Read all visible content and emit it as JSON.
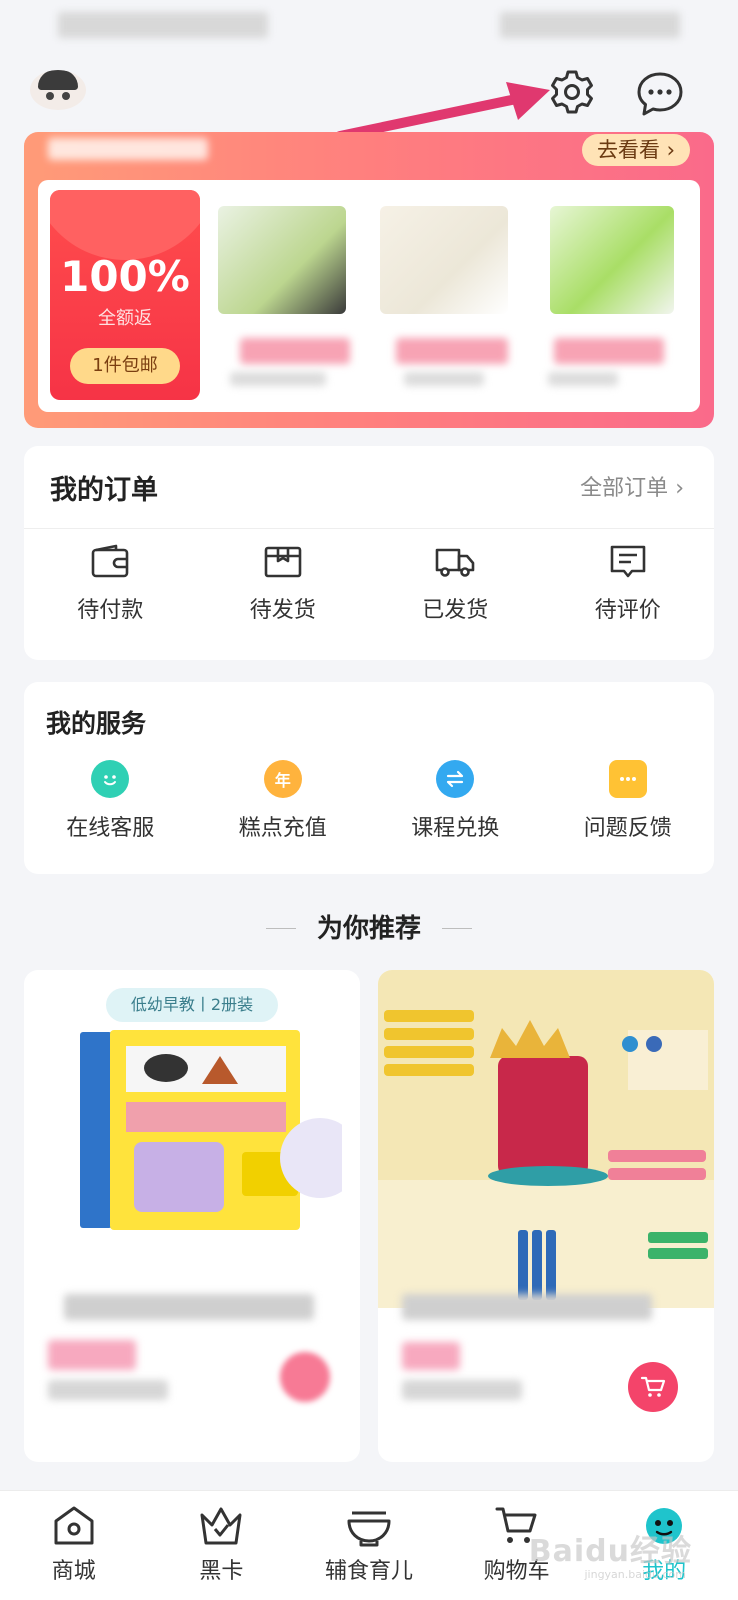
{
  "header": {
    "settings_icon": "gear-icon",
    "message_icon": "chat-bubble-icon"
  },
  "promo": {
    "go_look": "去看看",
    "go_look_icon": "chevron-right-icon",
    "percent": "100%",
    "refund_label": "全额返",
    "free_shipping": "1件包邮"
  },
  "orders": {
    "title": "我的订单",
    "all_orders": "全部订单",
    "all_orders_icon": "chevron-right-icon",
    "items": [
      {
        "label": "待付款",
        "icon": "wallet-icon"
      },
      {
        "label": "待发货",
        "icon": "package-box-icon"
      },
      {
        "label": "已发货",
        "icon": "delivery-truck-icon"
      },
      {
        "label": "待评价",
        "icon": "review-message-icon"
      }
    ]
  },
  "services": {
    "title": "我的服务",
    "items": [
      {
        "label": "在线客服",
        "icon": "smiley-icon",
        "color": "#2fd0b4"
      },
      {
        "label": "糕点充值",
        "icon": "year-coin-icon",
        "glyph": "年",
        "color": "#ffb33d"
      },
      {
        "label": "课程兑换",
        "icon": "exchange-arrows-icon",
        "color": "#33a9f0"
      },
      {
        "label": "问题反馈",
        "icon": "feedback-dots-icon",
        "color": "#ffc234"
      }
    ]
  },
  "recommend": {
    "title": "为你推荐",
    "products": [
      {
        "tag": "低幼早教丨2册装",
        "image_icon": "picture-book-icon",
        "cart_icon": "cart-icon"
      },
      {
        "image_icon": "crayon-set-icon",
        "cart_icon": "cart-icon"
      }
    ]
  },
  "tabbar": {
    "tabs": [
      {
        "label": "商城",
        "icon": "home-icon",
        "active": false
      },
      {
        "label": "黑卡",
        "icon": "crown-icon",
        "active": false
      },
      {
        "label": "辅食育儿",
        "icon": "bowl-icon",
        "active": false
      },
      {
        "label": "购物车",
        "icon": "cart-icon",
        "active": false
      },
      {
        "label": "我的",
        "icon": "profile-face-icon",
        "active": true
      }
    ],
    "active_color": "#1fc4cc"
  },
  "watermark": {
    "text": "Baidu经验",
    "sub": "jingyan.baidu.com"
  }
}
